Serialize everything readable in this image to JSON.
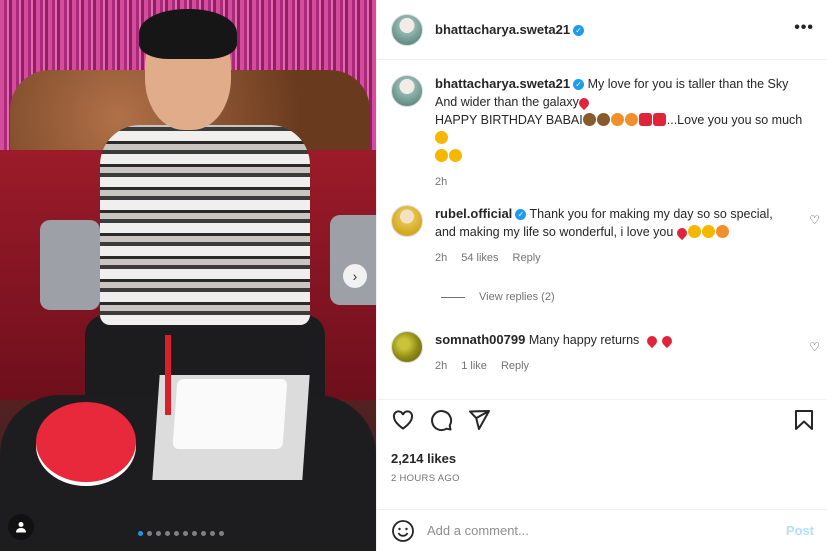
{
  "post": {
    "username": "bhattacharya.sweta21",
    "more_label": "•••",
    "photo_alt": "Man in patterned shirt with birthday cakes",
    "carousel_count": 10,
    "carousel_active": 0
  },
  "caption": {
    "username": "bhattacharya.sweta21",
    "line1": "My love for you is taller than the Sky",
    "line2": "And wider than the galaxy",
    "line3": "HAPPY BIRTHDAY BABAI",
    "line3_tail": "...Love you you so much",
    "age": "2h"
  },
  "comments": [
    {
      "username": "rubel.official",
      "text": "Thank you for making my day so so special, and making my life so wonderful, i love you",
      "age": "2h",
      "likes": "54 likes",
      "reply": "Reply",
      "view_replies": "View replies (2)"
    },
    {
      "username": "somnath00799",
      "text": "Many happy returns",
      "age": "2h",
      "likes": "1 like",
      "reply": "Reply"
    }
  ],
  "stats": {
    "likes": "2,214 likes",
    "time": "2 HOURS AGO"
  },
  "composer": {
    "placeholder": "Add a comment...",
    "post_label": "Post"
  },
  "colors": {
    "verified": "#1d9bf0",
    "post_button": "#b2dffc",
    "carousel_active": "#1b95f0"
  }
}
